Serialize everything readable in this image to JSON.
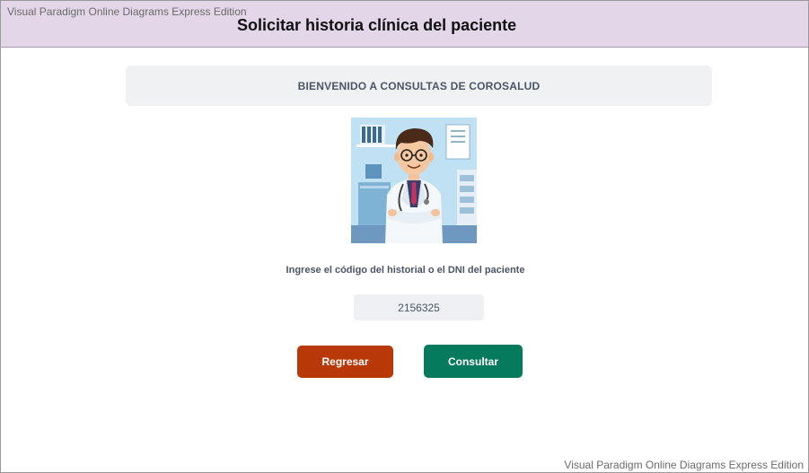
{
  "header": {
    "watermark": "Visual Paradigm Online Diagrams Express Edition",
    "title": "Solicitar historia clínica del paciente"
  },
  "main": {
    "welcome": "BIENVENIDO A CONSULTAS DE COROSALUD",
    "image": "doctor-illustration",
    "prompt": "Ingrese el código del historial o el DNI del paciente",
    "code_value": "2156325",
    "buttons": {
      "back_label": "Regresar",
      "query_label": "Consultar"
    }
  },
  "footer": {
    "watermark": "Visual Paradigm Online Diagrams Express Edition"
  },
  "colors": {
    "header_bg": "#e2d6e8",
    "back_button": "#b83807",
    "query_button": "#067a5c"
  }
}
